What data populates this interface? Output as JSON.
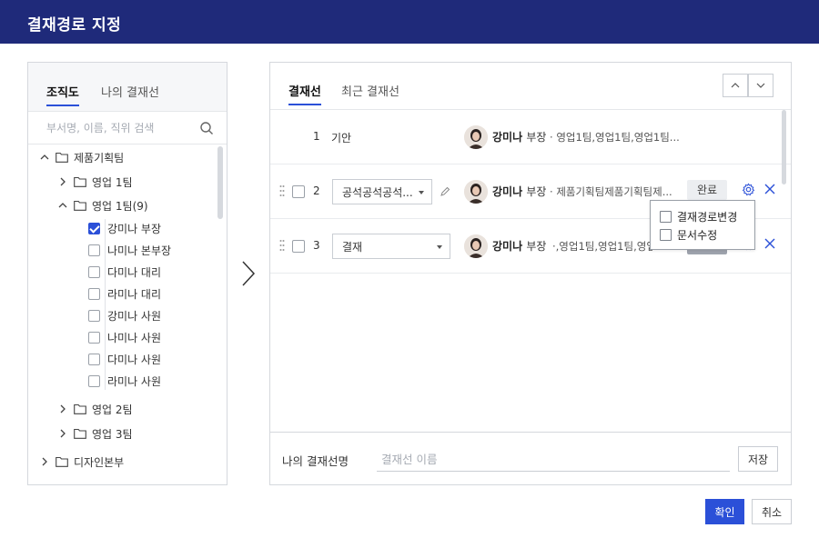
{
  "dialog": {
    "title": "결재경로 지정"
  },
  "left": {
    "tabs": [
      "조직도",
      "나의 결재선"
    ],
    "search_placeholder": "부서명, 이름, 직위 검색",
    "tree": {
      "root1": "제품기획팀",
      "team1": "영업 1팀",
      "team1b": "영업 1팀(9)",
      "members": [
        {
          "name": "강미나 부장",
          "checked": true
        },
        {
          "name": "나미나 본부장",
          "checked": false
        },
        {
          "name": "다미나 대리",
          "checked": false
        },
        {
          "name": "라미나 대리",
          "checked": false
        },
        {
          "name": "강미나 사원",
          "checked": false
        },
        {
          "name": "나미나 사원",
          "checked": false
        },
        {
          "name": "다미나 사원",
          "checked": false
        },
        {
          "name": "라미나 사원",
          "checked": false
        }
      ],
      "team2": "영업 2팀",
      "team3": "영업 3팀",
      "root2": "디자인본부"
    }
  },
  "right": {
    "tabs": [
      "결재선",
      "최근 결재선"
    ],
    "rows": [
      {
        "num": "1",
        "type": "기안",
        "name": "강미나",
        "rank": "부장",
        "dept": "영업1팀,영업1팀,영업1팀..."
      },
      {
        "num": "2",
        "type": "공석공석공석...",
        "name": "강미나",
        "rank": "부장",
        "dept": "제품기획팀제품기획팀제...",
        "status": "완료"
      },
      {
        "num": "3",
        "type": "결재",
        "name": "강미나",
        "rank": "부장",
        "dept": ",영업1팀,영업1팀,영업1팀..."
      }
    ],
    "popup": [
      "결재경로변경",
      "문서수정"
    ],
    "my_line_label": "나의 결재선명",
    "my_line_placeholder": "결재선 이름",
    "save_label": "저장"
  },
  "buttons": {
    "confirm": "확인",
    "cancel": "취소"
  },
  "colors": {
    "header": "#1f2a7a",
    "accent": "#2b50d8"
  }
}
